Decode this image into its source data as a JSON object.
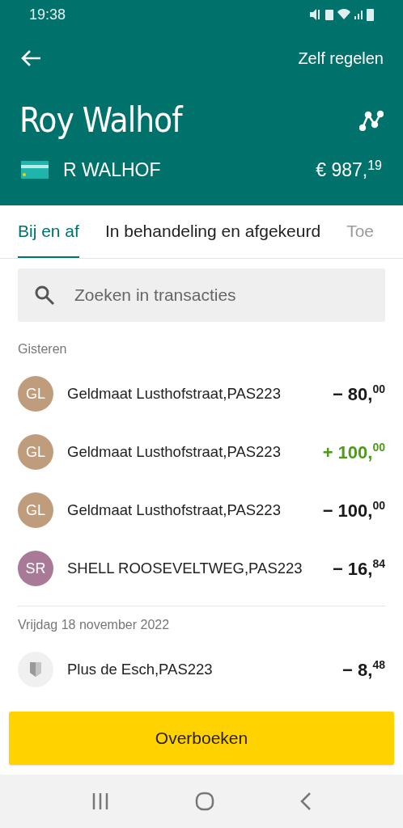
{
  "status_bar": {
    "time": "19:38"
  },
  "header": {
    "action": "Zelf regelen",
    "name": "Roy Walhof",
    "account_holder": "R WALHOF",
    "balance": "€ 987,$^{19}$"
  },
  "tabs": [
    {
      "label": "Bij en af",
      "selected": true
    },
    {
      "label": "In behandeling en afgekeurd",
      "selected": false
    },
    {
      "label": "Toe",
      "selected": false
    }
  ],
  "search": {
    "placeholder": "Zoeken in transacties"
  },
  "groups": [
    {
      "date": "Gisteren",
      "transactions": [
        {
          "kind": "debit",
          "initials": "GL",
          "color": "#bf9c7c",
          "description": "Geldmaat Lusthofstraat,PAS223",
          "amount": "− 80,$^{00}$"
        },
        {
          "kind": "credit",
          "initials": "GL",
          "color": "#bf9c7c",
          "description": "Geldmaat Lusthofstraat,PAS223",
          "amount": "+ 100,$^{00}$"
        },
        {
          "kind": "debit",
          "initials": "GL",
          "color": "#bf9c7c",
          "description": "Geldmaat Lusthofstraat,PAS223",
          "amount": "− 100,$^{00}$"
        },
        {
          "kind": "debit",
          "initials": "SR",
          "color": "#a87a98",
          "description": "SHELL ROOSEVELTWEG,PAS223",
          "amount": "− 16,$^{84}$"
        }
      ]
    },
    {
      "date": "Vrijdag 18 november 2022",
      "transactions": [
        {
          "kind": "debit",
          "description": "Plus de Esch,PAS223",
          "amount": "− 8,$^{48}$"
        }
      ]
    }
  ],
  "primary_button": "Overboeken"
}
